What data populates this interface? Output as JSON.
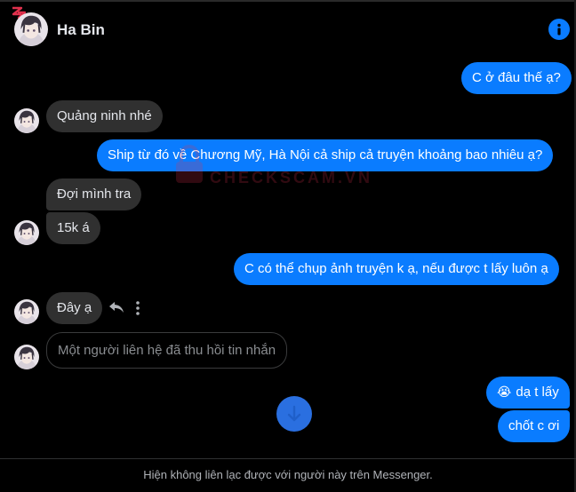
{
  "header": {
    "name": "Ha Bin",
    "info_icon": "info-icon",
    "brand_icon": "messenger-logo"
  },
  "messages": [
    {
      "dir": "out",
      "text": "C ở đâu thế ạ?"
    },
    {
      "dir": "in",
      "text": "Quảng ninh nhé"
    },
    {
      "dir": "out",
      "text": "Ship từ đó về Chương Mỹ, Hà Nội cả ship cả truyện khoảng bao nhiêu ạ?"
    },
    {
      "dir": "in",
      "text": "Đợi mình tra"
    },
    {
      "dir": "in",
      "text": "15k á"
    },
    {
      "dir": "out",
      "text": "C có thể chụp ảnh truyện k ạ, nếu được t lấy luôn ạ"
    },
    {
      "dir": "in",
      "text": "Đây ạ"
    },
    {
      "dir": "in",
      "text": "Một người liên hệ đã thu hồi tin nhắn",
      "unsent": true
    },
    {
      "dir": "out",
      "text": "dạ t lấy",
      "emoji": "😭"
    },
    {
      "dir": "out",
      "text": "chốt c ơi"
    }
  ],
  "actions": {
    "reply_icon": "reply-icon",
    "more_icon": "more-options-icon"
  },
  "scroll_button_icon": "scroll-down-icon",
  "watermark": "CHECKSCAM.VN",
  "footer": {
    "notice": "Hiện không liên lạc được với người này trên Messenger."
  },
  "colors": {
    "outgoing": "#0a7cff",
    "incoming": "#303030",
    "background": "#000000",
    "watermark": "#e0314d"
  }
}
